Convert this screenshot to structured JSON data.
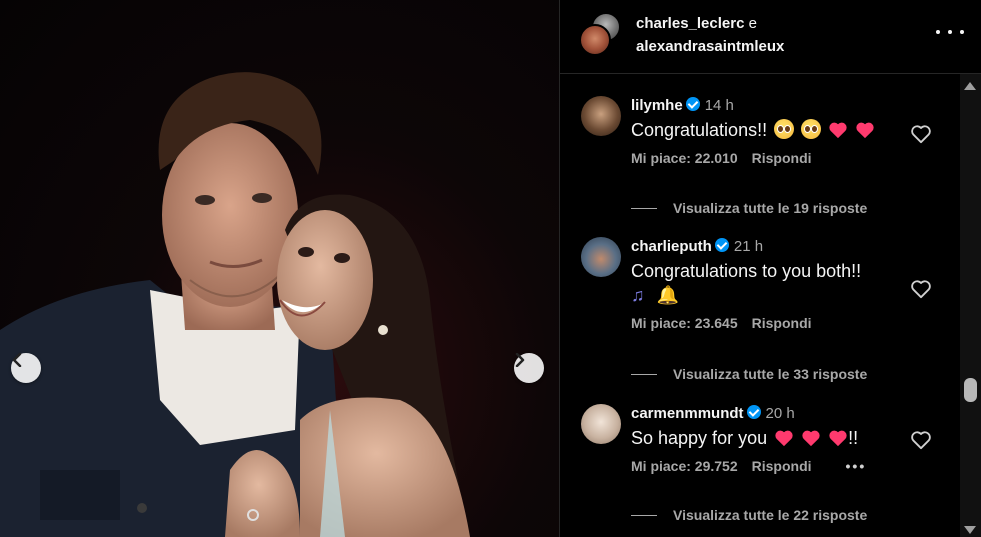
{
  "post": {
    "author_primary": "charles_leclerc",
    "conjunction": "e",
    "author_secondary": "alexandrasaintmleux",
    "more_icon": "more-horizontal-icon"
  },
  "carousel": {
    "prev_icon": "chevron-left-icon",
    "next_icon": "chevron-right-icon"
  },
  "comments": [
    {
      "username": "lilymhe",
      "verified": true,
      "time": "14 h",
      "text": "Congratulations!!",
      "emoji": [
        "pleading-face",
        "pleading-face",
        "pink-heart",
        "pink-heart"
      ],
      "likes": "Mi piace: 22.010",
      "reply": "Rispondi",
      "view_replies": "Visualizza tutte le 19 risposte"
    },
    {
      "username": "charlieputh",
      "verified": true,
      "time": "21 h",
      "text": "Congratulations to you both!!",
      "emoji": [
        "musical-notes",
        "bell"
      ],
      "likes": "Mi piace: 23.645",
      "reply": "Rispondi",
      "view_replies": "Visualizza tutte le 33 risposte"
    },
    {
      "username": "carmenmmundt",
      "verified": true,
      "time": "20 h",
      "text": "So happy for you",
      "text_suffix": "!!",
      "emoji": [
        "sparkling-heart",
        "sparkling-heart",
        "sparkling-heart"
      ],
      "likes": "Mi piace: 29.752",
      "reply": "Rispondi",
      "options": "•••",
      "view_replies": "Visualizza tutte le 22 risposte"
    }
  ],
  "colors": {
    "background": "#000000",
    "verified": "#0095f6",
    "muted_text": "#a8a8a8",
    "heart": "#ff3a6e"
  }
}
